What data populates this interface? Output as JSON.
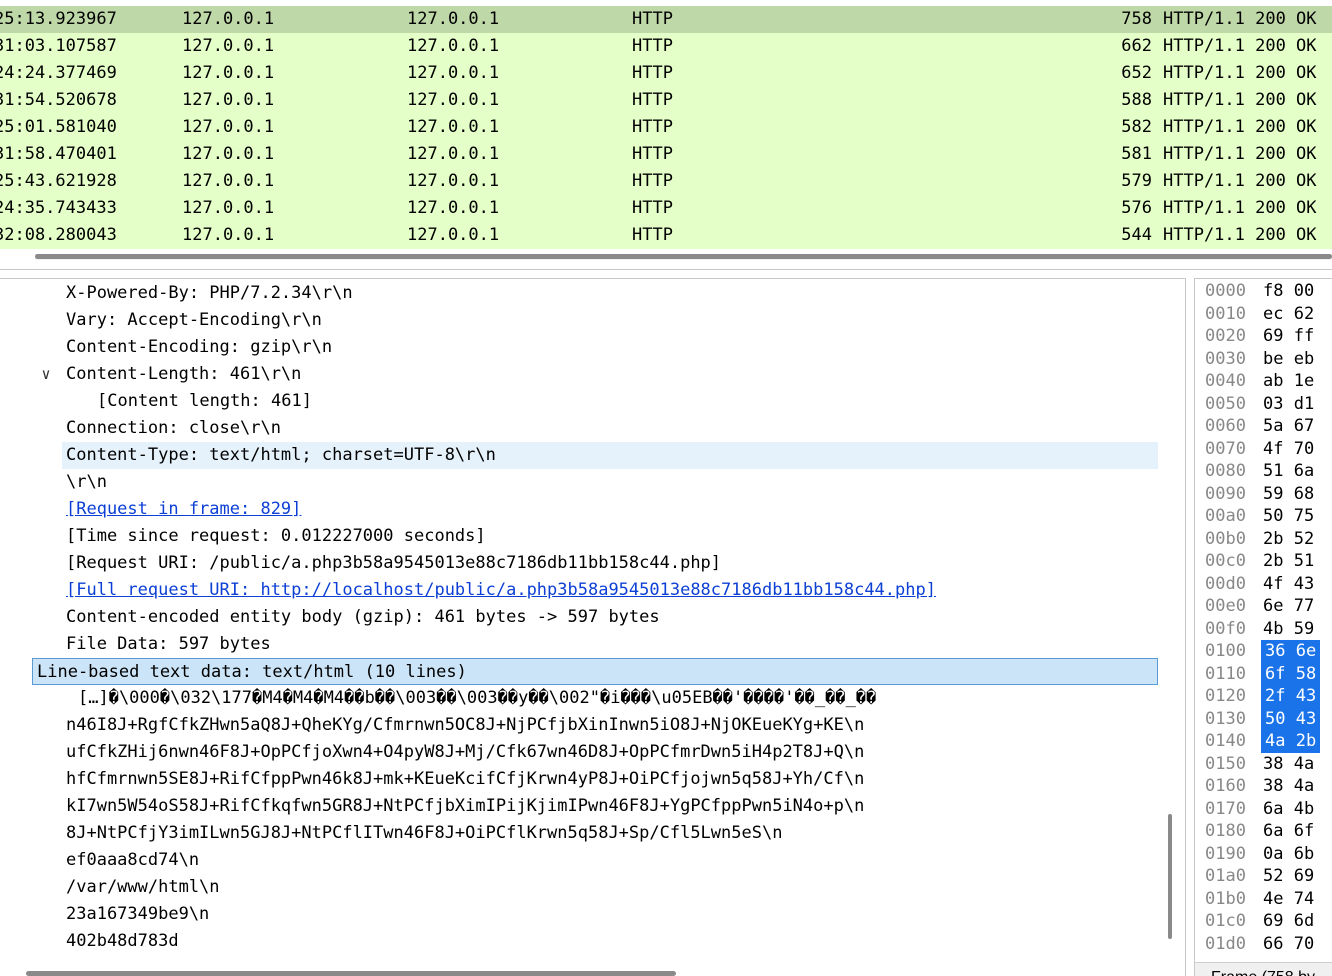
{
  "packet_list": {
    "rows": [
      {
        "time": "25:13.923967",
        "src": "127.0.0.1",
        "dst": "127.0.0.1",
        "proto": "HTTP",
        "len": "758",
        "info": "HTTP/1.1 200 OK",
        "selected": true
      },
      {
        "time": "31:03.107587",
        "src": "127.0.0.1",
        "dst": "127.0.0.1",
        "proto": "HTTP",
        "len": "662",
        "info": "HTTP/1.1 200 OK"
      },
      {
        "time": "24:24.377469",
        "src": "127.0.0.1",
        "dst": "127.0.0.1",
        "proto": "HTTP",
        "len": "652",
        "info": "HTTP/1.1 200 OK"
      },
      {
        "time": "31:54.520678",
        "src": "127.0.0.1",
        "dst": "127.0.0.1",
        "proto": "HTTP",
        "len": "588",
        "info": "HTTP/1.1 200 OK"
      },
      {
        "time": "25:01.581040",
        "src": "127.0.0.1",
        "dst": "127.0.0.1",
        "proto": "HTTP",
        "len": "582",
        "info": "HTTP/1.1 200 OK"
      },
      {
        "time": "31:58.470401",
        "src": "127.0.0.1",
        "dst": "127.0.0.1",
        "proto": "HTTP",
        "len": "581",
        "info": "HTTP/1.1 200 OK"
      },
      {
        "time": "25:43.621928",
        "src": "127.0.0.1",
        "dst": "127.0.0.1",
        "proto": "HTTP",
        "len": "579",
        "info": "HTTP/1.1 200 OK"
      },
      {
        "time": "24:35.743433",
        "src": "127.0.0.1",
        "dst": "127.0.0.1",
        "proto": "HTTP",
        "len": "576",
        "info": "HTTP/1.1 200 OK"
      },
      {
        "time": "32:08.280043",
        "src": "127.0.0.1",
        "dst": "127.0.0.1",
        "proto": "HTTP",
        "len": "544",
        "info": "HTTP/1.1 200 OK"
      }
    ]
  },
  "details": {
    "lines": [
      {
        "text": "X-Powered-By: PHP/7.2.34\\r\\n",
        "indent": 1
      },
      {
        "text": "Vary: Accept-Encoding\\r\\n",
        "indent": 1
      },
      {
        "text": "Content-Encoding: gzip\\r\\n",
        "indent": 1
      },
      {
        "text": "Content-Length: 461\\r\\n",
        "indent": 1,
        "expanded": true
      },
      {
        "text": "[Content length: 461]",
        "indent": 2
      },
      {
        "text": "Connection: close\\r\\n",
        "indent": 1
      },
      {
        "text": "Content-Type: text/html; charset=UTF-8\\r\\n",
        "indent": 1,
        "highlight": "light"
      },
      {
        "text": "\\r\\n",
        "indent": 1
      },
      {
        "text": "[Request in frame: 829]",
        "indent": 1,
        "link": true
      },
      {
        "text": "[Time since request: 0.012227000 seconds]",
        "indent": 1
      },
      {
        "text": "[Request URI: /public/a.php3b58a9545013e88c7186db11bb158c44.php]",
        "indent": 1
      },
      {
        "text": "[Full request URI: http://localhost/public/a.php3b58a9545013e88c7186db11bb158c44.php]",
        "indent": 1,
        "link": true
      },
      {
        "text": "Content-encoded entity body (gzip): 461 bytes -> 597 bytes",
        "indent": 1
      },
      {
        "text": "File Data: 597 bytes",
        "indent": 1
      },
      {
        "text": "Line-based text data: text/html (10 lines)",
        "indent": 0,
        "expanded": true,
        "highlight": "selected"
      },
      {
        "text": "[…]�\\000�\\032\\177�M4�M4�M4��b��\\003��\\003��y��\\002\"�i���\\u05EB��'����'��_��_��",
        "indent": 1.4
      },
      {
        "text": "n46I8J+RgfCfkZHwn5aQ8J+QheKYg/Cfmrnwn5OC8J+NjPCfjbXinInwn5iO8J+NjOKEueKYg+KE\\n",
        "indent": 1
      },
      {
        "text": "ufCfkZHij6nwn46F8J+OpPCfjoXwn4+O4pyW8J+Mj/Cfk67wn46D8J+OpPCfmrDwn5iH4p2T8J+Q\\n",
        "indent": 1
      },
      {
        "text": "hfCfmrnwn5SE8J+RifCfppPwn46k8J+mk+KEueKcifCfjKrwn4yP8J+OiPCfjojwn5q58J+Yh/Cf\\n",
        "indent": 1
      },
      {
        "text": "kI7wn5W54oS58J+RifCfkqfwn5GR8J+NtPCfjbXimIPijKjimIPwn46F8J+YgPCfppPwn5iN4o+p\\n",
        "indent": 1
      },
      {
        "text": "8J+NtPCfjY3imILwn5GJ8J+NtPCflITwn46F8J+OiPCflKrwn5q58J+Sp/Cfl5Lwn5eS\\n",
        "indent": 1
      },
      {
        "text": "ef0aaa8cd74\\n",
        "indent": 1
      },
      {
        "text": "/var/www/html\\n",
        "indent": 1
      },
      {
        "text": "23a167349be9\\n",
        "indent": 1
      },
      {
        "text": "402b48d783d",
        "indent": 1
      }
    ]
  },
  "hex": {
    "rows": [
      {
        "off": "0000",
        "bytes": "f8 00"
      },
      {
        "off": "0010",
        "bytes": "ec 62"
      },
      {
        "off": "0020",
        "bytes": "69 ff"
      },
      {
        "off": "0030",
        "bytes": "be eb"
      },
      {
        "off": "0040",
        "bytes": "ab 1e"
      },
      {
        "off": "0050",
        "bytes": "03 d1"
      },
      {
        "off": "0060",
        "bytes": "5a 67"
      },
      {
        "off": "0070",
        "bytes": "4f 70"
      },
      {
        "off": "0080",
        "bytes": "51 6a"
      },
      {
        "off": "0090",
        "bytes": "59 68"
      },
      {
        "off": "00a0",
        "bytes": "50 75"
      },
      {
        "off": "00b0",
        "bytes": "2b 52"
      },
      {
        "off": "00c0",
        "bytes": "2b 51"
      },
      {
        "off": "00d0",
        "bytes": "4f 43"
      },
      {
        "off": "00e0",
        "bytes": "6e 77"
      },
      {
        "off": "00f0",
        "bytes": "4b 59"
      },
      {
        "off": "0100",
        "bytes": "36 6e",
        "selected": true
      },
      {
        "off": "0110",
        "bytes": "6f 58",
        "selected": true
      },
      {
        "off": "0120",
        "bytes": "2f 43",
        "selected": true
      },
      {
        "off": "0130",
        "bytes": "50 43",
        "selected": true
      },
      {
        "off": "0140",
        "bytes": "4a 2b",
        "selected": true
      },
      {
        "off": "0150",
        "bytes": "38 4a"
      },
      {
        "off": "0160",
        "bytes": "38 4a"
      },
      {
        "off": "0170",
        "bytes": "6a 4b"
      },
      {
        "off": "0180",
        "bytes": "6a 6f"
      },
      {
        "off": "0190",
        "bytes": "0a 6b"
      },
      {
        "off": "01a0",
        "bytes": "52 69"
      },
      {
        "off": "01b0",
        "bytes": "4e 74"
      },
      {
        "off": "01c0",
        "bytes": "69 6d"
      },
      {
        "off": "01d0",
        "bytes": "66 70"
      }
    ],
    "footer": "Frame (758 by"
  },
  "colors": {
    "http_row": "#e4ffc7",
    "http_row_selected": "#bfd8a8",
    "tree_selected": "#cce4f7",
    "hex_selected": "#1a73e8",
    "link": "#0b3fd6"
  }
}
